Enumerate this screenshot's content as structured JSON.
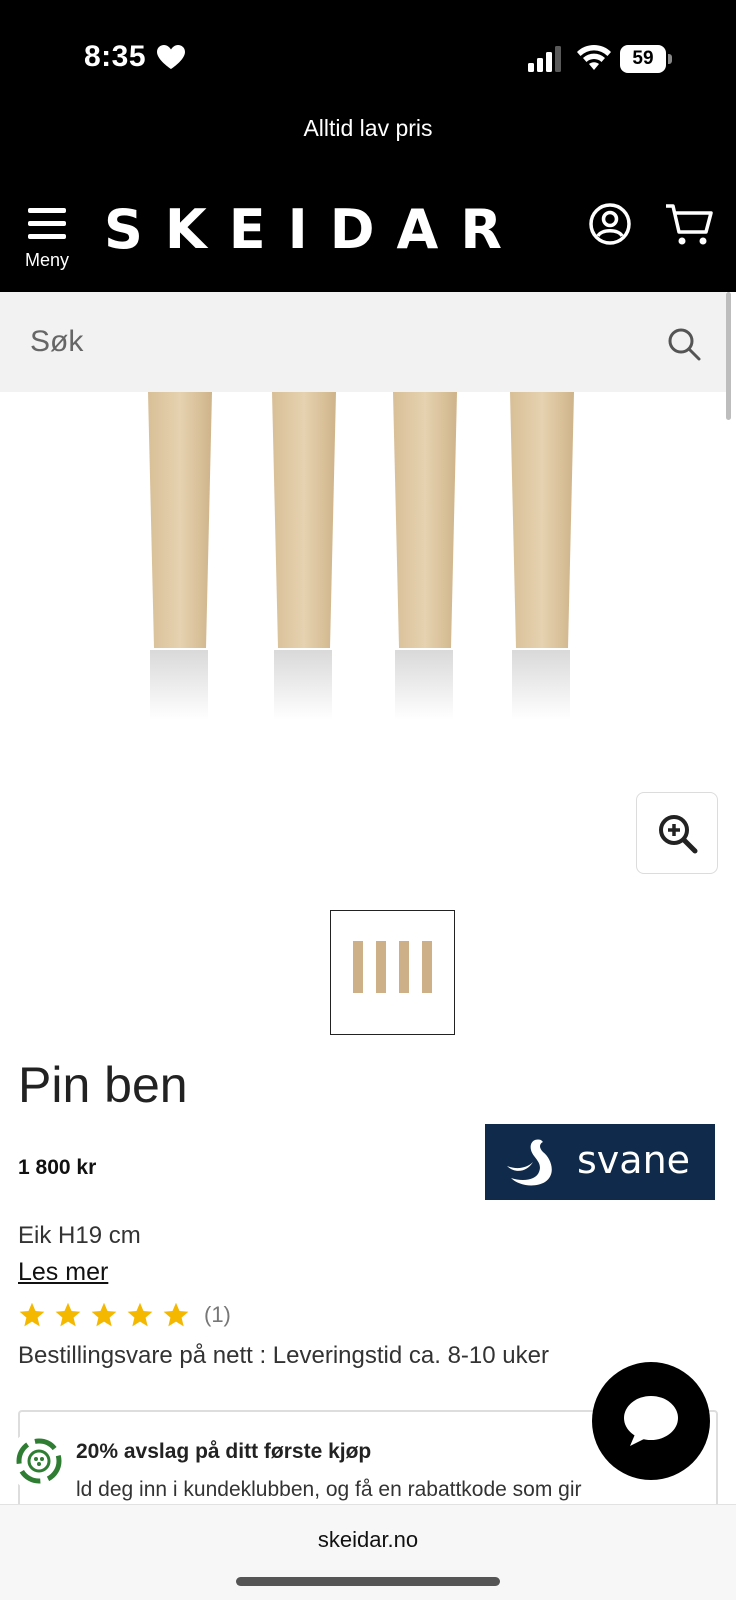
{
  "status_bar": {
    "time": "8:35",
    "battery": "59"
  },
  "promo": {
    "text": "Alltid lav pris"
  },
  "header": {
    "menu_label": "Meny",
    "logo": "SKEIDAR"
  },
  "search": {
    "placeholder": "Søk"
  },
  "product": {
    "title": "Pin ben",
    "price": "1 800 kr",
    "variant": "Eik H19 cm",
    "read_more": "Les mer",
    "rating": 5,
    "review_count": "(1)",
    "delivery": "Bestillingsvare på nett : Leveringstid ca. 8-10 uker",
    "brand": "svane"
  },
  "club": {
    "title": "20% avslag på ditt første kjøp",
    "text": "ld deg inn i kundeklubben, og få en rabattkode som gir"
  },
  "browser": {
    "url": "skeidar.no"
  },
  "colors": {
    "brand_navy": "#0f2a4a",
    "star_yellow": "#f5b800",
    "header_black": "#000000"
  }
}
